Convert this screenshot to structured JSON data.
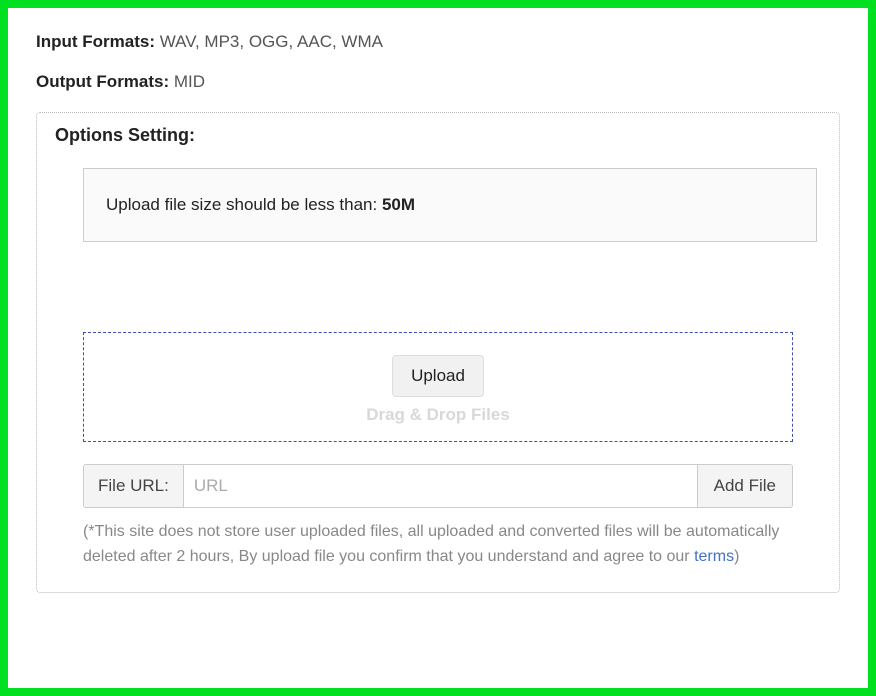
{
  "input_formats": {
    "label": "Input Formats: ",
    "values": "WAV, MP3, OGG, AAC, WMA"
  },
  "output_formats": {
    "label": "Output Formats: ",
    "values": "MID"
  },
  "options": {
    "title": "Options Setting:",
    "info_prefix": "Upload file size should be less than: ",
    "info_limit": "50M"
  },
  "dropzone": {
    "upload_label": "Upload",
    "hint": "Drag & Drop Files"
  },
  "url_row": {
    "label": "File URL:",
    "placeholder": "URL",
    "add_label": "Add File"
  },
  "disclaimer": {
    "prefix": "(*This site does not store user uploaded files, all uploaded and converted files will be automatically deleted after 2 hours, By upload file you confirm that you understand and agree to our ",
    "terms_label": "terms",
    "suffix": ")"
  }
}
